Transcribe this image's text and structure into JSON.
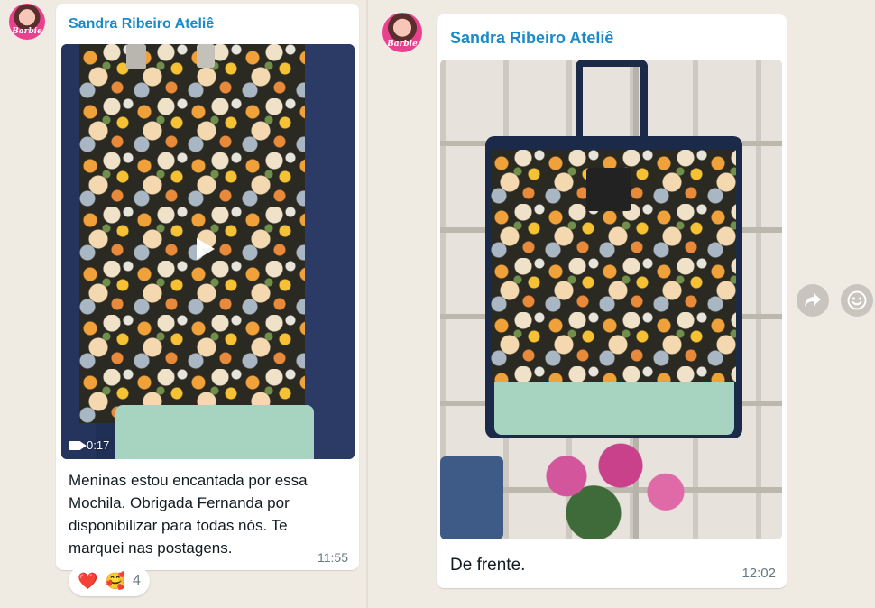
{
  "chat": {
    "messages": [
      {
        "sender": "Sandra Ribeiro Ateliê",
        "avatar_text": "Barbie",
        "media_type": "video",
        "duration": "0:17",
        "caption_lines": [
          "Meninas estou encantada por essa",
          "Mochila. Obrigada Fernanda por",
          "disponibilizar para todas nós. Te",
          "marquei nas postagens."
        ],
        "time": "11:55",
        "reactions": {
          "emoji_1": "❤️",
          "emoji_2": "🥰",
          "count": "4"
        }
      },
      {
        "sender": "Sandra Ribeiro Ateliê",
        "avatar_text": "Barbie",
        "media_type": "image",
        "caption": "De frente.",
        "time": "12:02"
      }
    ],
    "side_actions": {
      "forward_icon": "forward-icon",
      "react_icon": "emoji-icon"
    }
  },
  "colors": {
    "background": "#efeae2",
    "bubble": "#ffffff",
    "sender_name": "#1c8ac9",
    "timestamp": "#667781",
    "bag_mint": "#a6d4c0",
    "bag_navy": "#1c2a4a"
  }
}
